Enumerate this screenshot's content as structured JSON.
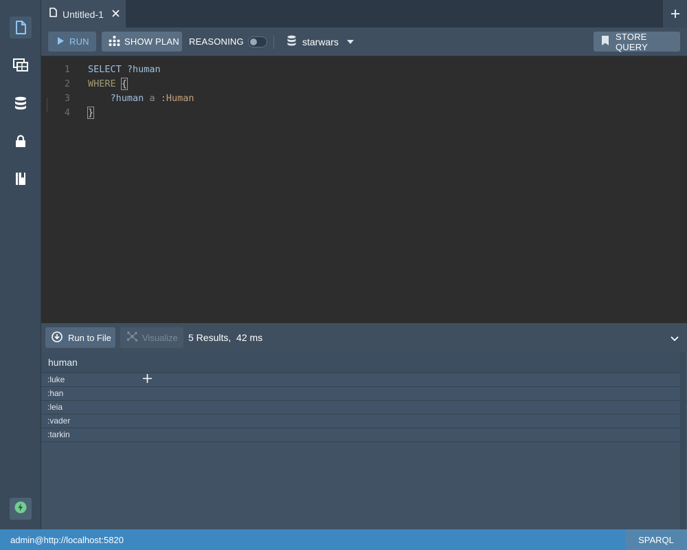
{
  "tabs": [
    {
      "label": "Untitled-1"
    }
  ],
  "toolbar": {
    "run_label": "RUN",
    "show_plan_label": "SHOW PLAN",
    "reasoning_label": "REASONING",
    "reasoning_enabled": false,
    "database": "starwars",
    "store_query_label": "STORE QUERY"
  },
  "editor": {
    "lines": [
      {
        "number": "1"
      },
      {
        "number": "2"
      },
      {
        "number": "3"
      },
      {
        "number": "4"
      }
    ],
    "tokens": {
      "select": "SELECT",
      "select_var": "?human",
      "where": "WHERE",
      "open_brace": "{",
      "subject": "?human",
      "predicate": "a",
      "object": ":Human",
      "close_brace": "}"
    }
  },
  "results": {
    "run_to_file_label": "Run to File",
    "visualize_label": "Visualize",
    "summary": "5 Results,  42 ms",
    "column": "human",
    "rows": [
      ":luke",
      ":han",
      ":leia",
      ":vader",
      ":tarkin"
    ]
  },
  "statusbar": {
    "connection": "admin@http://localhost:5820",
    "mode": "SPARQL"
  },
  "colors": {
    "accent": "#3d88c1",
    "run_text": "#8fc5f2",
    "editor_bg": "#2d2d2d"
  },
  "icons": [
    "document-icon",
    "table-icon",
    "database-icon",
    "lock-icon",
    "book-icon",
    "lightning-icon",
    "play-icon",
    "plan-icon",
    "bookmark-icon",
    "download-icon",
    "visualize-icon",
    "close-icon",
    "plus-icon",
    "chevron-down-icon"
  ]
}
